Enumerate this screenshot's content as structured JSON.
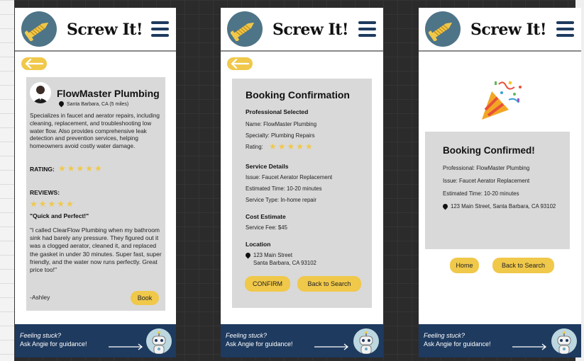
{
  "app": {
    "brand": "Screw It!"
  },
  "colors": {
    "accent": "#f0c84a",
    "navy": "#1e3a5f",
    "logo_bg": "#4e7487",
    "card": "#d9d9d9"
  },
  "icons": {
    "logo": "screw-icon",
    "menu": "hamburger-menu-icon",
    "back": "arrow-left-icon",
    "location": "location-pin-icon",
    "star": "star-icon",
    "celebration": "party-popper-icon",
    "assistant": "robot-icon"
  },
  "footer": {
    "question": "Feeling stuck?",
    "prompt": "Ask Angie for guidance!"
  },
  "profile": {
    "name": "FlowMaster Plumbing",
    "location": "Santa Barbara, CA (5 miles)",
    "description": "Specializes in faucet and aerator repairs, including cleaning, replacement, and troubleshooting low water flow. Also provides comprehensive leak detection and prevention services, helping homeowners avoid costly water damage.",
    "rating_label": "RATING:",
    "rating": 5,
    "reviews_label": "REVIEWS:",
    "review": {
      "stars": 5,
      "title": "\"Quick and Perfect!\"",
      "text": "\"I called ClearFlow Plumbing when my bathroom sink had barely any pressure. They figured out it was a clogged aerator, cleaned it, and replaced the gasket in under 30 minutes. Super fast, super friendly, and the water now runs perfectly. Great price too!\"",
      "author": "-Ashley"
    },
    "book_label": "Book"
  },
  "booking": {
    "title": "Booking Confirmation",
    "professional_heading": "Professional Selected",
    "name_line": "Name: FlowMaster Plumbing",
    "specialty_line": "Specialty: Plumbing Repairs",
    "rating_label": "Rating:",
    "rating": 5,
    "service_heading": "Service Details",
    "issue_line": "Issue: Faucet Aerator Replacement",
    "time_line": "Estimated Time: 10-20 minutes",
    "type_line": "Service Type: In-home repair",
    "cost_heading": "Cost Estimate",
    "fee_line": "Service Fee: $45",
    "location_heading": "Location",
    "address_line1": "123 Main Street",
    "address_line2": "Santa Barbara, CA 93102",
    "confirm_label": "CONFIRM",
    "back_label": "Back to Search"
  },
  "confirmed": {
    "title": "Booking Confirmed!",
    "professional_line": "Professional: FlowMaster Plumbing",
    "issue_line": "Issue: Faucet Aerator Replacement",
    "time_line": "Estimated Time: 10-20 minutes",
    "address_line": "123 Main Street, Santa Barbara, CA 93102",
    "home_label": "Home",
    "back_label": "Back to Search"
  }
}
